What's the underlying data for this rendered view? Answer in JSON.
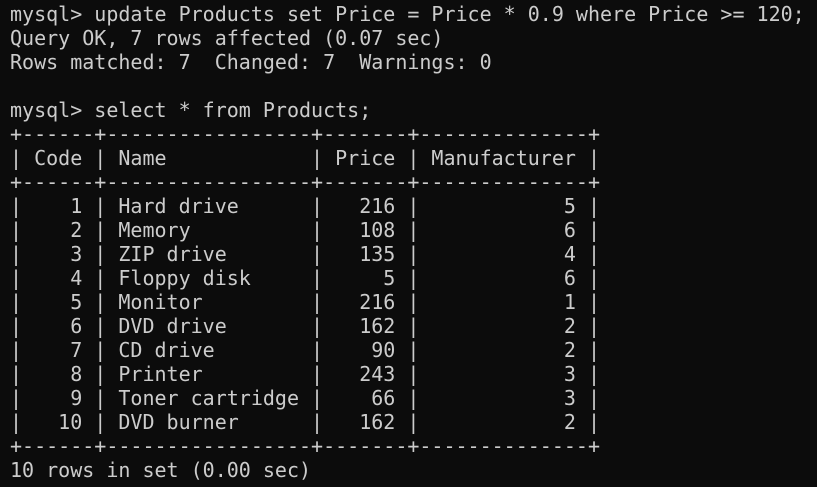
{
  "terminal": {
    "lines": [
      "mysql> update Products set Price = Price * 0.9 where Price >= 120;",
      "Query OK, 7 rows affected (0.07 sec)",
      "Rows matched: 7  Changed: 7  Warnings: 0",
      "",
      "mysql> select * from Products;",
      "+------+-----------------+-------+--------------+",
      "| Code | Name            | Price | Manufacturer |",
      "+------+-----------------+-------+--------------+",
      "|    1 | Hard drive      |   216 |            5 |",
      "|    2 | Memory          |   108 |            6 |",
      "|    3 | ZIP drive       |   135 |            4 |",
      "|    4 | Floppy disk     |     5 |            6 |",
      "|    5 | Monitor         |   216 |            1 |",
      "|    6 | DVD drive       |   162 |            2 |",
      "|    7 | CD drive        |    90 |            2 |",
      "|    8 | Printer         |   243 |            3 |",
      "|    9 | Toner cartridge |    66 |            3 |",
      "|   10 | DVD burner      |   162 |            2 |",
      "+------+-----------------+-------+--------------+",
      "10 rows in set (0.00 sec)"
    ]
  }
}
